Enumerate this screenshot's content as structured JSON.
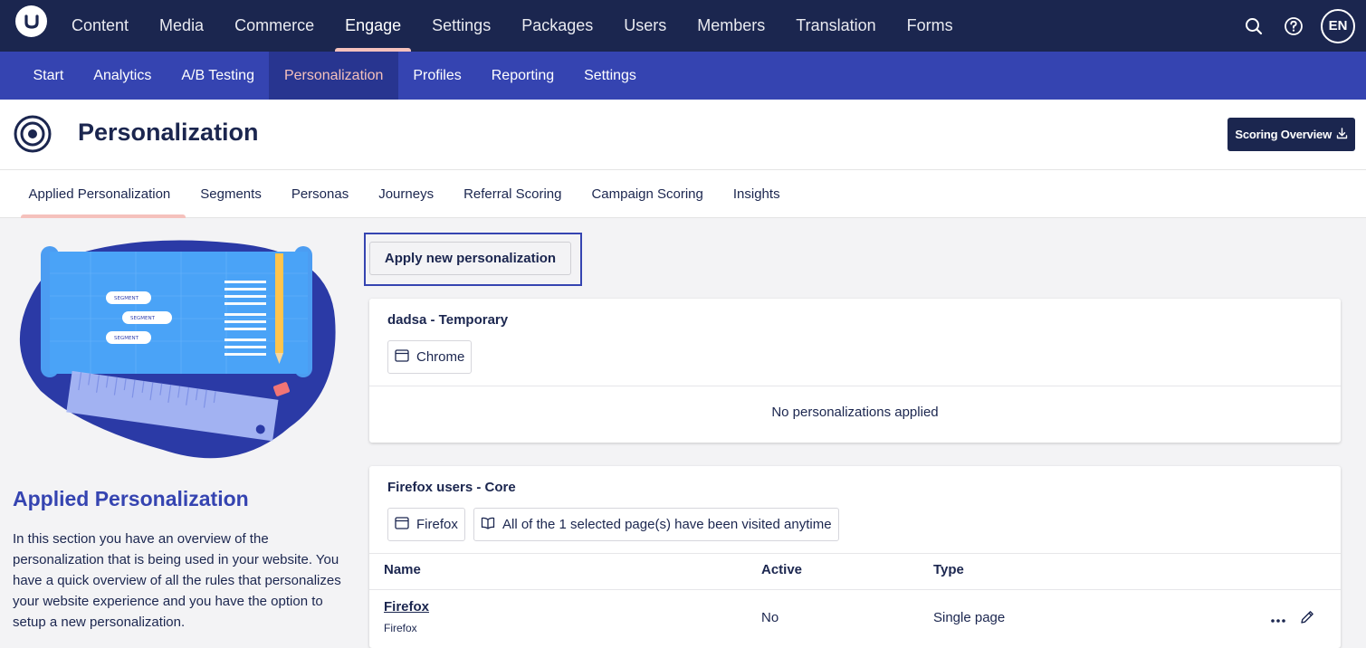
{
  "topnav": {
    "items": [
      {
        "label": "Content"
      },
      {
        "label": "Media"
      },
      {
        "label": "Commerce"
      },
      {
        "label": "Engage"
      },
      {
        "label": "Settings"
      },
      {
        "label": "Packages"
      },
      {
        "label": "Users"
      },
      {
        "label": "Members"
      },
      {
        "label": "Translation"
      },
      {
        "label": "Forms"
      }
    ],
    "active": "Engage",
    "user_initials": "EN"
  },
  "subnav": {
    "items": [
      {
        "label": "Start"
      },
      {
        "label": "Analytics"
      },
      {
        "label": "A/B Testing"
      },
      {
        "label": "Personalization"
      },
      {
        "label": "Profiles"
      },
      {
        "label": "Reporting"
      },
      {
        "label": "Settings"
      }
    ],
    "active": "Personalization"
  },
  "header": {
    "title": "Personalization",
    "scoring_button": "Scoring Overview"
  },
  "tabs": {
    "items": [
      {
        "label": "Applied Personalization"
      },
      {
        "label": "Segments"
      },
      {
        "label": "Personas"
      },
      {
        "label": "Journeys"
      },
      {
        "label": "Referral Scoring"
      },
      {
        "label": "Campaign Scoring"
      },
      {
        "label": "Insights"
      }
    ],
    "active": "Applied Personalization"
  },
  "sidebar": {
    "illustration_labels": [
      "SEGMENT",
      "SEGMENT",
      "SEGMENT"
    ],
    "title": "Applied Personalization",
    "description": "In this section you have an overview of the personalization that is being used in your website. You have a quick overview of all the rules that personalizes your website experience and you have the option to setup a new personalization."
  },
  "main": {
    "apply_button": "Apply new personalization",
    "segments": [
      {
        "title": "dadsa - Temporary",
        "chips": [
          {
            "icon": "browser-icon",
            "label": "Chrome"
          }
        ],
        "empty_message": "No personalizations applied"
      },
      {
        "title": "Firefox users - Core",
        "chips": [
          {
            "icon": "browser-icon",
            "label": "Firefox"
          },
          {
            "icon": "book-icon",
            "label": "All of the 1 selected page(s) have been visited anytime"
          }
        ],
        "columns": [
          "Name",
          "Active",
          "Type"
        ],
        "rows": [
          {
            "name": "Firefox",
            "subname": "Firefox",
            "active": "No",
            "type": "Single page"
          }
        ]
      }
    ]
  },
  "colors": {
    "topbar": "#1b264f",
    "subnav": "#3544b1",
    "accent": "#f5c1bc"
  }
}
